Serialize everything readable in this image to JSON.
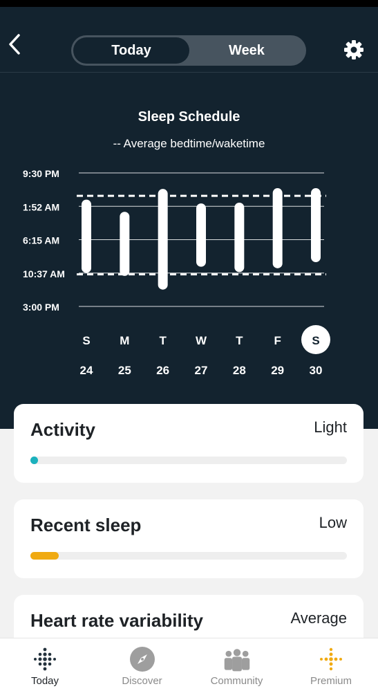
{
  "header": {
    "tabs": [
      {
        "label": "Today",
        "active": true
      },
      {
        "label": "Week",
        "active": false
      }
    ]
  },
  "chart_data": {
    "type": "bar",
    "title": "Sleep Schedule",
    "legend": "--   Average bedtime/waketime",
    "y_tick_labels": [
      "9:30 PM",
      "1:52 AM",
      "6:15 AM",
      "10:37 AM",
      "3:00 PM"
    ],
    "x_day_letters": [
      "S",
      "M",
      "T",
      "W",
      "T",
      "F",
      "S"
    ],
    "x_dates": [
      "24",
      "25",
      "26",
      "27",
      "28",
      "29",
      "30"
    ],
    "selected_index": 6,
    "ylim_hours_after_9_30pm": [
      0,
      17.5
    ],
    "bedtime_hours_after_9_30pm": [
      3.5,
      5.1,
      2.1,
      4.0,
      3.9,
      2.0,
      2.0
    ],
    "waketime_hours_after_9_30pm": [
      13.1,
      13.5,
      15.3,
      12.3,
      13.0,
      12.5,
      11.7
    ],
    "avg_bedtime_hours_after_9_30pm": 3.0,
    "avg_waketime_hours_after_9_30pm": 13.3,
    "colors": {
      "bar": "#ffffff",
      "background": "#13232f",
      "grid": "#ffffff"
    }
  },
  "cards": [
    {
      "title": "Activity",
      "value": "Light",
      "level": 0.01,
      "color": "#1bb1bd"
    },
    {
      "title": "Recent sleep",
      "value": "Low",
      "level": 0.09,
      "color": "#f0aa12"
    },
    {
      "title": "Heart rate variability",
      "value": "Average",
      "level": null,
      "color": "#1bb1bd"
    }
  ],
  "tabbar": {
    "items": [
      {
        "label": "Today",
        "icon": "dots-grid-icon",
        "active": true
      },
      {
        "label": "Discover",
        "icon": "compass-icon",
        "active": false
      },
      {
        "label": "Community",
        "icon": "people-icon",
        "active": false
      },
      {
        "label": "Premium",
        "icon": "premium-dots-icon",
        "active": false
      }
    ]
  }
}
